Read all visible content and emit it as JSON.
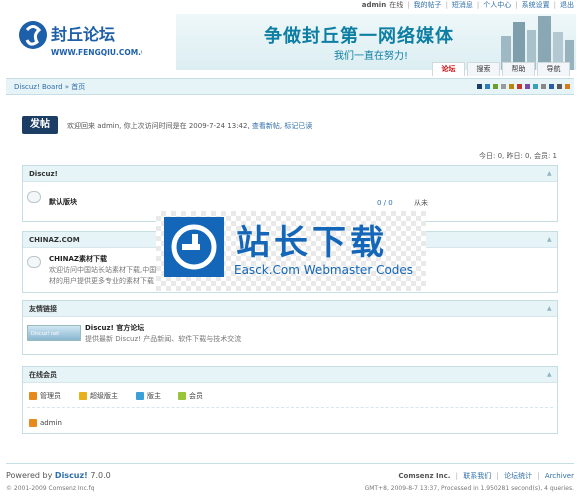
{
  "topbar": {
    "user": "admin",
    "status": "在线",
    "links": [
      "我的帖子",
      "短消息",
      "个人中心",
      "系统设置",
      "退出"
    ]
  },
  "header": {
    "logo_name": "封丘论坛",
    "logo_url": "WWW.FENGQIU.COM.CN",
    "slogan": "争做封丘第一网络媒体",
    "slogan_sub": "我们一直在努力!"
  },
  "nav": {
    "tabs": [
      "论坛",
      "搜索",
      "帮助",
      "导航"
    ],
    "active": "论坛"
  },
  "breadcrumb": "Discuz! Board » 首页",
  "style_swatches": [
    "#1a3d6b",
    "#2d7fb8",
    "#6a9e2d",
    "#9a9a9a",
    "#b8860b",
    "#c23a2c",
    "#7d4aa8",
    "#3aa1b8",
    "#888888",
    "#2b5fa5",
    "#5a5a5a",
    "#d77a1c"
  ],
  "post_button": "发帖",
  "welcome": {
    "text": "欢迎回来  admin, 你上次访问时间是在  2009-7-24 13:42,",
    "link1": "查看新帖",
    "link2": "标记已读"
  },
  "stats": "今日: 0, 昨日: 0, 会员: 1",
  "forums": [
    {
      "category": "Discuz!",
      "forum_name": "默认版块",
      "counts": "0 / 0",
      "last": "从未"
    },
    {
      "category": "CHINAZ.COM",
      "forum_name": "CHINAZ素材下载",
      "desc1": "欢迎访问中国站长站素材下载,中国",
      "desc2": "材的用户提供更多专业的素材下载"
    }
  ],
  "links_box": {
    "title": "友情链接",
    "site_name": "Discuz! 官方论坛",
    "site_desc": "提供最新  Discuz! 产品新闻、软件下载与技术交流",
    "logo_text": "Discuz! net"
  },
  "online": {
    "title": "在线会员",
    "legend": [
      {
        "label": "管理员",
        "color": "#e88a1a"
      },
      {
        "label": "超级版主",
        "color": "#e8b01a"
      },
      {
        "label": "版主",
        "color": "#3aa1d8"
      },
      {
        "label": "会员",
        "color": "#9ac43a"
      }
    ],
    "members": [
      "admin"
    ]
  },
  "footer": {
    "powered_prefix": "Powered by",
    "powered_name": "Discuz!",
    "version": "7.0.0",
    "copyright": "© 2001-2009 Comsenz Inc.fq",
    "links": [
      "Comsenz Inc.",
      "联系我们",
      "论坛统计",
      "Archiver"
    ],
    "gmt": "GMT+8, 2009-8-7 13:37, Processed in 1.950281 second(s), 4 queries."
  },
  "watermark": {
    "title": "站长下载",
    "sub": "Easck.Com Webmaster Codes"
  }
}
